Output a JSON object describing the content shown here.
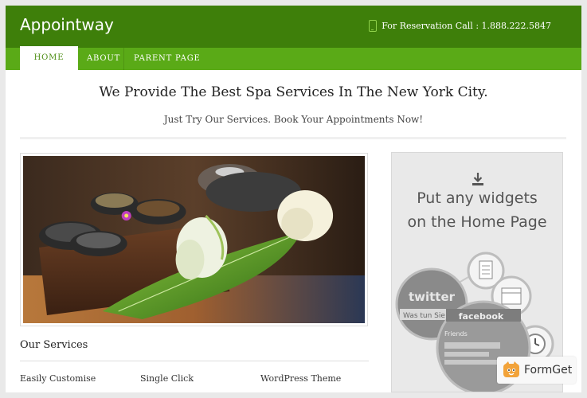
{
  "header": {
    "site_title": "Appointway",
    "reservation": "For Reservation Call : 1.888.222.5847"
  },
  "nav": {
    "items": [
      {
        "label": "HOME",
        "active": true
      },
      {
        "label": "ABOUT",
        "active": false
      },
      {
        "label": "PARENT PAGE",
        "active": false
      }
    ]
  },
  "main": {
    "headline": "We Provide The Best Spa Services In The New York City.",
    "subheadline": "Just Try Our Services. Book Your Appointments Now!",
    "services_title": "Our Services",
    "services": [
      "Easily Customise",
      "Single Click",
      "WordPress Theme"
    ]
  },
  "sidebar": {
    "widget_line1": "Put any widgets",
    "widget_line2": "on the Home Page",
    "twitter_label": "twitter",
    "twitter_caption": "Was tun Sie g",
    "facebook_label": "facebook",
    "facebook_caption": "Friends"
  },
  "badge": {
    "label": "FormGet"
  },
  "colors": {
    "header_bg": "#3e7f0a",
    "nav_bg": "#5aaa17",
    "accent": "#8fd14a",
    "widget_bg": "#e9e9e9"
  },
  "icons": [
    "phone-icon",
    "download-icon",
    "formget-logo-icon"
  ]
}
